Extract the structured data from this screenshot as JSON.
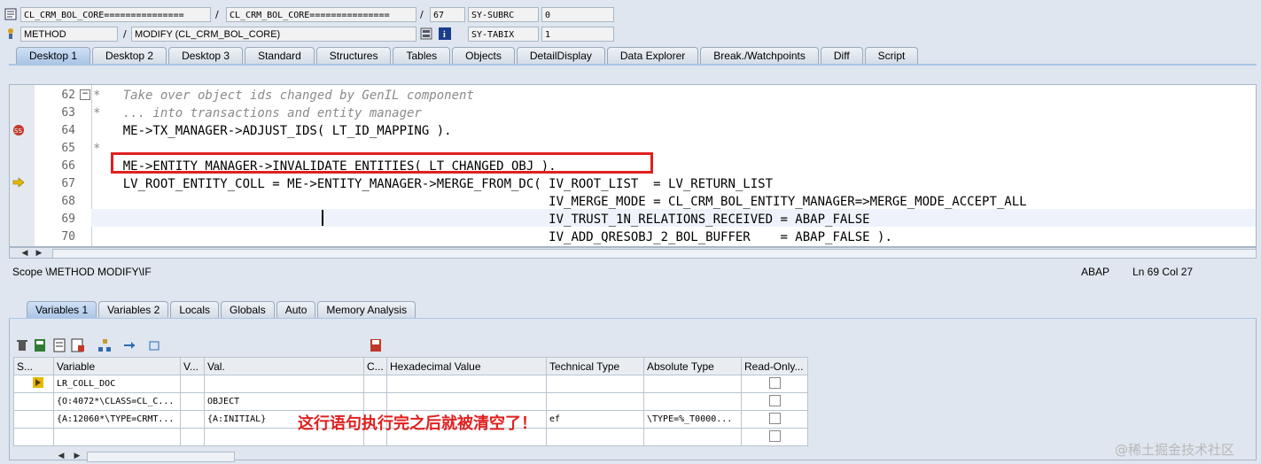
{
  "header": {
    "row1": {
      "program": "CL_CRM_BOL_CORE===============",
      "include": "CL_CRM_BOL_CORE===============",
      "line": "67",
      "sys_label": "SY-SUBRC",
      "sys_value": "0"
    },
    "row2": {
      "event_type": "METHOD",
      "event_name": "MODIFY (CL_CRM_BOL_CORE)",
      "sys_label": "SY-TABIX",
      "sys_value": "1"
    },
    "sep": "/"
  },
  "top_tabs": [
    "Desktop 1",
    "Desktop 2",
    "Desktop 3",
    "Standard",
    "Structures",
    "Tables",
    "Objects",
    "DetailDisplay",
    "Data Explorer",
    "Break./Watchpoints",
    "Diff",
    "Script"
  ],
  "code": {
    "lines": [
      {
        "no": "62",
        "text": "*   Take over object ids changed by GenIL component",
        "comment": true
      },
      {
        "no": "63",
        "text": "*   ... into transactions and entity manager",
        "comment": true
      },
      {
        "no": "64",
        "text": "    ME->TX_MANAGER->ADJUST_IDS( LT_ID_MAPPING ).",
        "comment": false
      },
      {
        "no": "65",
        "text": "*",
        "comment": true
      },
      {
        "no": "66",
        "text": "    ME->ENTITY_MANAGER->INVALIDATE_ENTITIES( LT_CHANGED_OBJ ).",
        "comment": false
      },
      {
        "no": "67",
        "text": "    LV_ROOT_ENTITY_COLL = ME->ENTITY_MANAGER->MERGE_FROM_DC( IV_ROOT_LIST  = LV_RETURN_LIST",
        "comment": false
      },
      {
        "no": "68",
        "text": "                                                             IV_MERGE_MODE = CL_CRM_BOL_ENTITY_MANAGER=>MERGE_MODE_ACCEPT_ALL",
        "comment": false
      },
      {
        "no": "69",
        "text": "                                                             IV_TRUST_1N_RELATIONS_RECEIVED = ABAP_FALSE",
        "comment": false
      },
      {
        "no": "70",
        "text": "                                                             IV_ADD_QRESOBJ_2_BOL_BUFFER    = ABAP_FALSE ).",
        "comment": false
      }
    ]
  },
  "status": {
    "scope": "Scope \\METHOD MODIFY\\IF",
    "lang": "ABAP",
    "pos": "Ln  69 Col  27"
  },
  "lower_tabs": [
    "Variables 1",
    "Variables 2",
    "Locals",
    "Globals",
    "Auto",
    "Memory Analysis"
  ],
  "grid": {
    "headers": [
      "S...",
      "Variable",
      "V...",
      "Val.",
      "C...",
      "Hexadecimal Value",
      "Technical Type",
      "Absolute Type",
      "Read-Only..."
    ],
    "rows": [
      {
        "variable": "LR_COLL_DOC",
        "val": "",
        "tech": "",
        "abs": ""
      },
      {
        "variable": "{O:4072*\\CLASS=CL_C...",
        "val": "OBJECT",
        "tech": "",
        "abs": ""
      },
      {
        "variable": "{A:12060*\\TYPE=CRMT...",
        "val": "{A:INITIAL}",
        "tech": "ef",
        "abs": "\\TYPE=%_T0000..."
      },
      {
        "variable": "",
        "val": "",
        "tech": "",
        "abs": ""
      }
    ]
  },
  "annotation": "这行语句执行完之后就被清空了！",
  "watermark": "@稀土掘金技术社区",
  "colors": {
    "highlight_box": "#e02020",
    "annotation": "#e02020"
  }
}
